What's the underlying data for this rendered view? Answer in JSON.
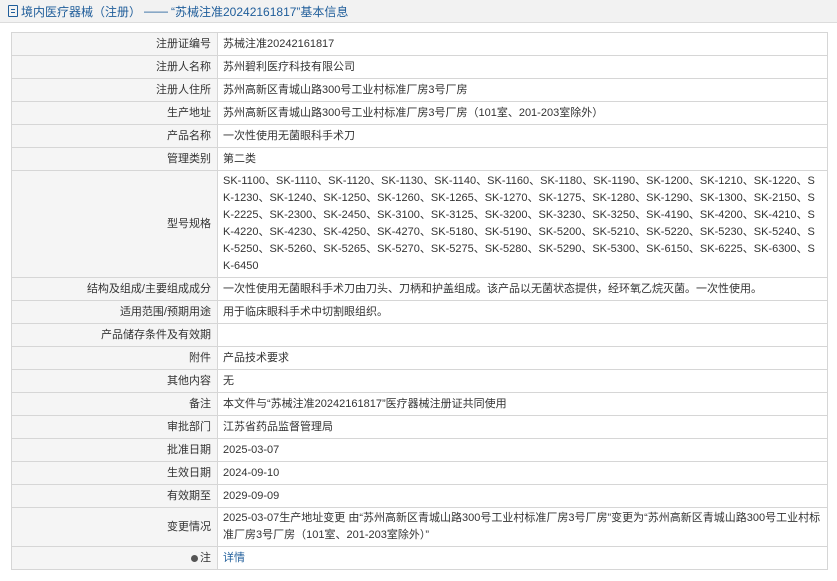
{
  "header": {
    "prefix": "境内医疗器械（注册）",
    "separator": "——",
    "title": "“苏械注准20242161817”基本信息"
  },
  "rows": [
    {
      "label": "注册证编号",
      "value": "苏械注准20242161817"
    },
    {
      "label": "注册人名称",
      "value": "苏州碧利医疗科技有限公司"
    },
    {
      "label": "注册人住所",
      "value": "苏州高新区青城山路300号工业村标准厂房3号厂房"
    },
    {
      "label": "生产地址",
      "value": "苏州高新区青城山路300号工业村标准厂房3号厂房（101室、201-203室除外）"
    },
    {
      "label": "产品名称",
      "value": "一次性使用无菌眼科手术刀"
    },
    {
      "label": "管理类别",
      "value": "第二类"
    },
    {
      "label": "型号规格",
      "value": "SK-1100、SK-1110、SK-1120、SK-1130、SK-1140、SK-1160、SK-1180、SK-1190、SK-1200、SK-1210、SK-1220、SK-1230、SK-1240、SK-1250、SK-1260、SK-1265、SK-1270、SK-1275、SK-1280、SK-1290、SK-1300、SK-2150、SK-2225、SK-2300、SK-2450、SK-3100、SK-3125、SK-3200、SK-3230、SK-3250、SK-4190、SK-4200、SK-4210、SK-4220、SK-4230、SK-4250、SK-4270、SK-5180、SK-5190、SK-5200、SK-5210、SK-5220、SK-5230、SK-5240、SK-5250、SK-5260、SK-5265、SK-5270、SK-5275、SK-5280、SK-5290、SK-5300、SK-6150、SK-6225、SK-6300、SK-6450"
    },
    {
      "label": "结构及组成/主要组成成分",
      "value": "一次性使用无菌眼科手术刀由刀头、刀柄和护盖组成。该产品以无菌状态提供，经环氧乙烷灭菌。一次性使用。"
    },
    {
      "label": "适用范围/预期用途",
      "value": "用于临床眼科手术中切割眼组织。"
    },
    {
      "label": "产品储存条件及有效期",
      "value": ""
    },
    {
      "label": "附件",
      "value": "产品技术要求"
    },
    {
      "label": "其他内容",
      "value": "无"
    },
    {
      "label": "备注",
      "value": "本文件与“苏械注准20242161817”医疗器械注册证共同使用"
    },
    {
      "label": "审批部门",
      "value": "江苏省药品监督管理局"
    },
    {
      "label": "批准日期",
      "value": "2025-03-07"
    },
    {
      "label": "生效日期",
      "value": "2024-09-10"
    },
    {
      "label": "有效期至",
      "value": "2029-09-09"
    },
    {
      "label": "变更情况",
      "value": "2025-03-07生产地址变更 由“苏州高新区青城山路300号工业村标准厂房3号厂房”变更为“苏州高新区青城山路300号工业村标准厂房3号厂房（101室、201-203室除外）”"
    },
    {
      "label": "注",
      "value": "详情"
    }
  ]
}
